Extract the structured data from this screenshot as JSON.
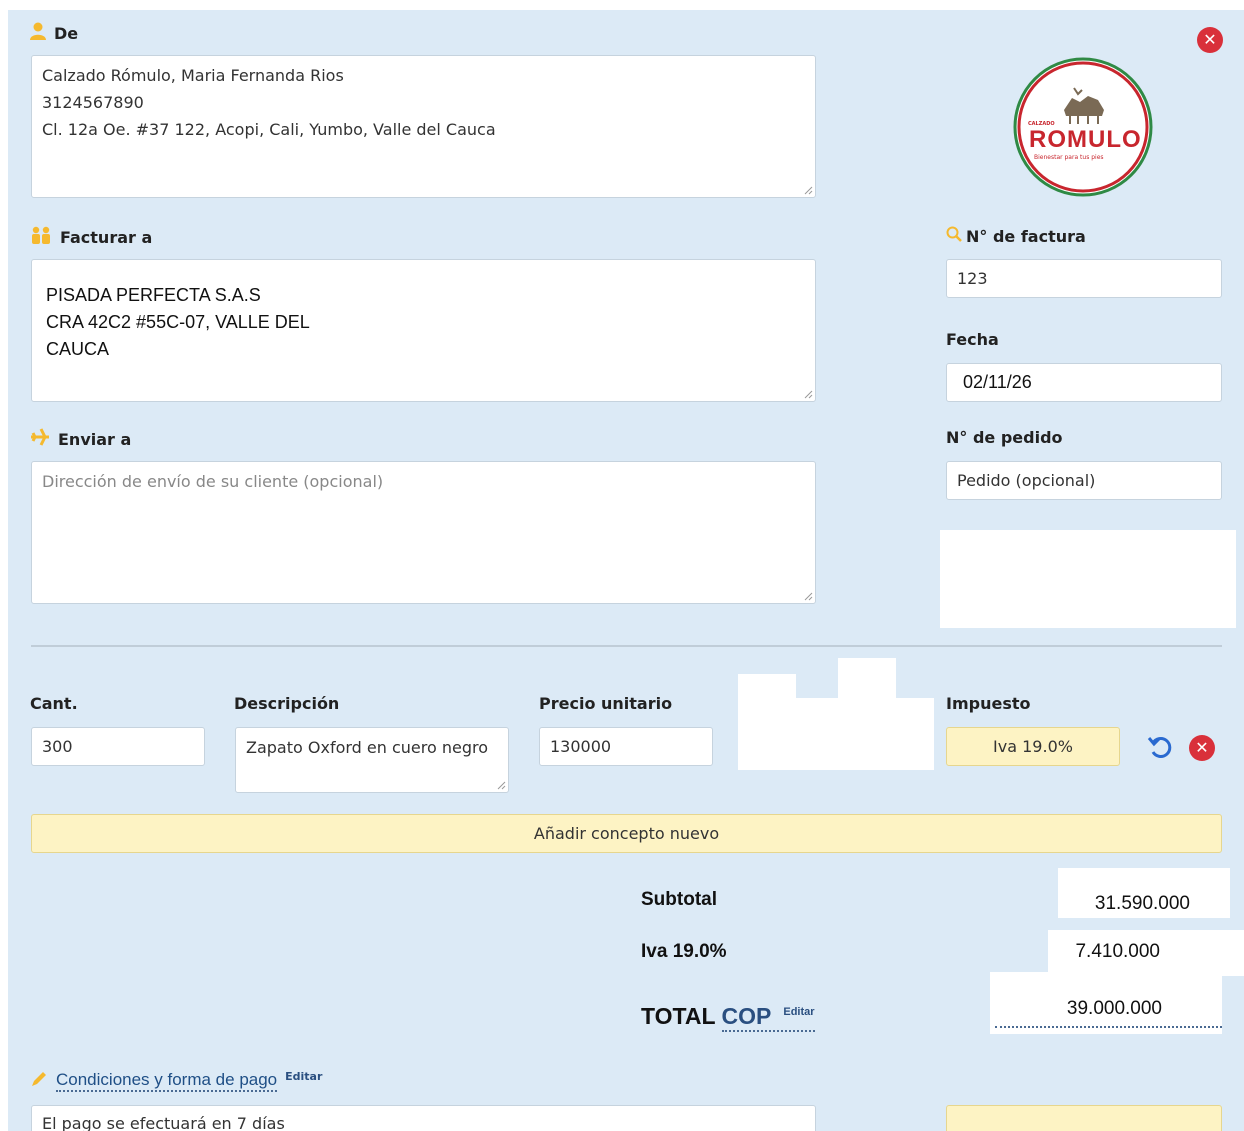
{
  "from": {
    "label": "De",
    "lines": [
      "Calzado Rómulo, Maria Fernanda Rios",
      "3124567890",
      "Cl. 12a Oe. #37 122, Acopi, Cali, Yumbo, Valle del Cauca"
    ]
  },
  "logo": {
    "small_text": "CALZADO",
    "brand": "ROMULO",
    "tagline": "Bienestar para tus pies",
    "colors": {
      "red": "#c8262e",
      "green": "#2f8a45"
    }
  },
  "bill_to": {
    "label": "Facturar a",
    "lines": [
      "PISADA PERFECTA S.A.S",
      "CRA 42C2 #55C-07, VALLE DEL",
      "CAUCA"
    ]
  },
  "invoice_number": {
    "label": "N° de factura",
    "value": "123"
  },
  "date": {
    "label": "Fecha",
    "value": "02/11/26"
  },
  "ship_to": {
    "label": "Enviar a",
    "placeholder": "Dirección de envío de su cliente (opcional)"
  },
  "order_number": {
    "label": "N° de pedido",
    "placeholder": "Pedido (opcional)"
  },
  "items": {
    "headers": {
      "qty": "Cant.",
      "description": "Descripción",
      "unit_price": "Precio unitario",
      "tax": "Impuesto"
    },
    "rows": [
      {
        "qty": "300",
        "description": "Zapato Oxford en cuero negro",
        "unit_price": "130000",
        "tax": "Iva 19.0%"
      }
    ],
    "add_button": "Añadir concepto nuevo"
  },
  "totals": {
    "subtotal_label": "Subtotal",
    "subtotal_value": "31.590.000",
    "tax_label": "Iva 19.0%",
    "tax_value": "7.410.000",
    "total_label": "TOTAL",
    "currency": "COP",
    "edit_label": "Editar",
    "total_value": "39.000.000"
  },
  "terms": {
    "label": "Condiciones y forma de pago",
    "edit_label": "Editar",
    "value": "El pago se efectuará en 7 días"
  },
  "icons": [
    "user-icon",
    "close-icon",
    "people-icon",
    "search-icon",
    "plane-icon",
    "undo-icon",
    "pencil-icon",
    "resize-grip-icon"
  ],
  "colors": {
    "background": "#dceaf6",
    "accent_yellow": "#fdf3c4",
    "danger": "#d9303a",
    "link": "#2a6ad0",
    "icon_orange": "#f5b92e"
  }
}
